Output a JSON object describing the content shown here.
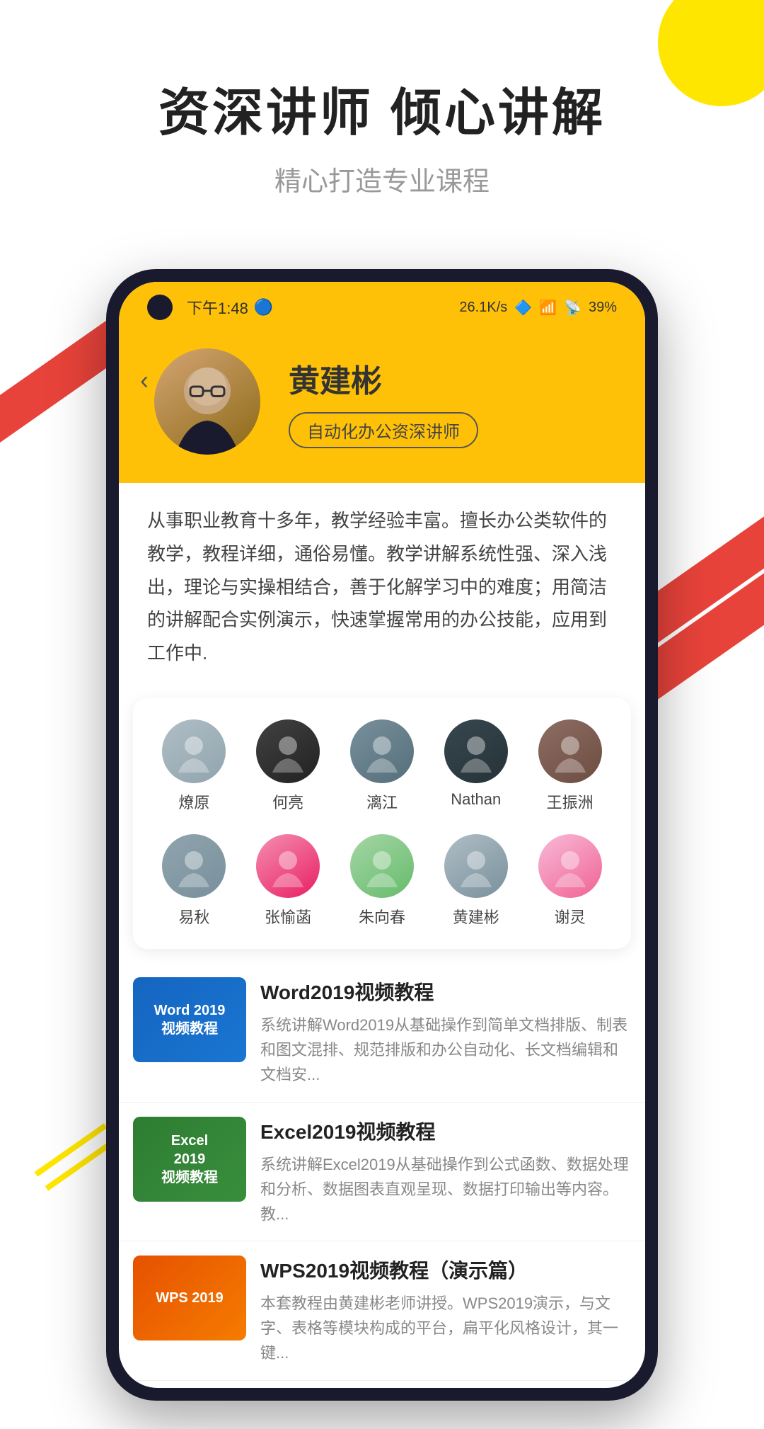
{
  "decorations": {
    "circle_color": "#FFE600",
    "stripe_color": "#E8433A"
  },
  "header": {
    "main_title": "资深讲师  倾心讲解",
    "sub_title": "精心打造专业课程"
  },
  "phone": {
    "status_bar": {
      "time": "下午1:48",
      "network_speed": "26.1K/s",
      "battery": "39%"
    },
    "teacher_profile": {
      "back_label": "‹",
      "name": "黄建彬",
      "badge": "自动化办公资深讲师",
      "description": "从事职业教育十多年，教学经验丰富。擅长办公类软件的教学，教程详细，通俗易懂。教学讲解系统性强、深入浅出，理论与实操相结合，善于化解学习中的难度；用简洁的讲解配合实例演示，快速掌握常用的办公技能，应用到工作中."
    },
    "instructors": {
      "row1": [
        {
          "name": "燎原",
          "av": "av-1"
        },
        {
          "name": "何亮",
          "av": "av-2"
        },
        {
          "name": "漓江",
          "av": "av-3"
        },
        {
          "name": "Nathan",
          "av": "av-4"
        },
        {
          "name": "王振洲",
          "av": "av-5"
        }
      ],
      "row2": [
        {
          "name": "易秋",
          "av": "av-6"
        },
        {
          "name": "张愉菡",
          "av": "av-7"
        },
        {
          "name": "朱向春",
          "av": "av-8"
        },
        {
          "name": "黄建彬",
          "av": "av-9"
        },
        {
          "name": "谢灵",
          "av": "av-10"
        }
      ]
    },
    "courses": [
      {
        "id": "word",
        "thumb_label": "Word 2019\n视频教程",
        "bg_class": "word-bg",
        "title": "Word2019视频教程",
        "desc": "系统讲解Word2019从基础操作到简单文档排版、制表和图文混排、规范排版和办公自动化、长文档编辑和文档安..."
      },
      {
        "id": "excel",
        "thumb_label": "Excel\n2019\n视频教程",
        "bg_class": "excel-bg",
        "title": "Excel2019视频教程",
        "desc": "系统讲解Excel2019从基础操作到公式函数、数据处理和分析、数据图表直观呈现、数据打印输出等内容。教..."
      },
      {
        "id": "wps",
        "thumb_label": "WPS 2019",
        "bg_class": "wps-bg",
        "title": "WPS2019视频教程（演示篇）",
        "desc": "本套教程由黄建彬老师讲授。WPS2019演示，与文字、表格等模块构成的平台，扁平化风格设计，其一键..."
      }
    ]
  }
}
